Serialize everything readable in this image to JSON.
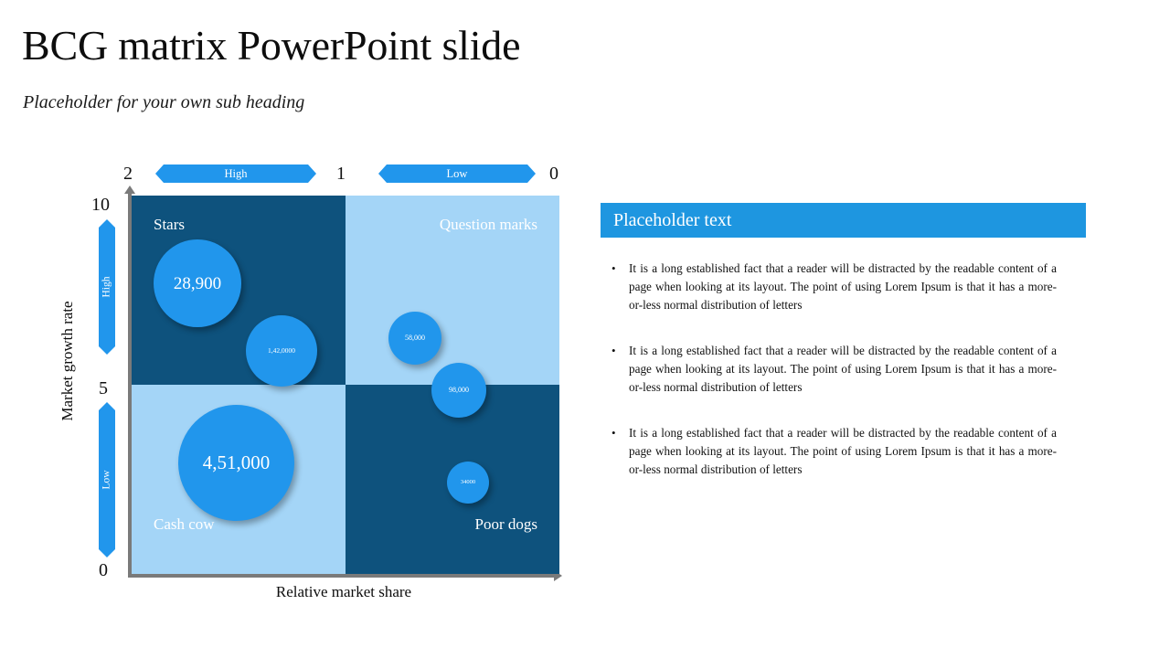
{
  "slide": {
    "title": "BCG matrix PowerPoint slide",
    "subtitle": "Placeholder for your own sub heading"
  },
  "matrix": {
    "x_axis": {
      "title": "Relative market share",
      "ticks": [
        "2",
        "1",
        "0"
      ],
      "bands": [
        {
          "label": "High"
        },
        {
          "label": "Low"
        }
      ]
    },
    "y_axis": {
      "title": "Market growth rate",
      "ticks": [
        "10",
        "5",
        "0"
      ],
      "bands": [
        {
          "label": "High"
        },
        {
          "label": "Low"
        }
      ]
    },
    "quadrants": [
      {
        "key": "stars",
        "label": "Stars",
        "fill": "#0e527d"
      },
      {
        "key": "question_marks",
        "label": "Question marks",
        "fill": "#a4d5f7"
      },
      {
        "key": "cash_cow",
        "label": "Cash cow",
        "fill": "#a4d5f7"
      },
      {
        "key": "poor_dogs",
        "label": "Poor dogs",
        "fill": "#0e527d"
      }
    ]
  },
  "chart_data": {
    "type": "scatter",
    "title": "BCG matrix PowerPoint slide",
    "xlabel": "Relative market share",
    "ylabel": "Market growth rate",
    "xlim": [
      2,
      0
    ],
    "ylim": [
      0,
      10
    ],
    "xticks": [
      "2",
      "1",
      "0"
    ],
    "yticks": [
      "10",
      "5",
      "0"
    ],
    "grid": false,
    "legend": "none",
    "bubble_color": "#2196ec",
    "quadrants": [
      "Stars",
      "Question marks",
      "Cash cow",
      "Poor dogs"
    ],
    "points": [
      {
        "quadrant": "Stars",
        "label": "28,900",
        "value": 28900,
        "size": 96
      },
      {
        "quadrant": "Stars",
        "label": "1,42,0000",
        "value": 1420000,
        "size": 78
      },
      {
        "quadrant": "Question marks",
        "label": "58,000",
        "value": 58000,
        "size": 58
      },
      {
        "quadrant": "Question marks",
        "label": "98,000",
        "value": 98000,
        "size": 60
      },
      {
        "quadrant": "Cash cow",
        "label": "4,51,000",
        "value": 451000,
        "size": 127
      },
      {
        "quadrant": "Poor dogs",
        "label": "34000",
        "value": 34000,
        "size": 46
      }
    ]
  },
  "panel": {
    "header": "Placeholder text",
    "bullet_marker": "•",
    "bullets": [
      "It is a long established fact that a reader will be distracted by the readable content of a page when looking at its layout. The point of using Lorem Ipsum is that it has a more-or-less normal distribution of letters",
      "It is a long established fact that a reader will be distracted by the readable content of a page when looking at its layout. The point of using Lorem Ipsum is that it has a more-or-less normal distribution of letters",
      "It is a long established fact that a reader will be distracted by the readable content of a page when looking at its layout. The point of using Lorem Ipsum is that it has a more-or-less normal distribution of letters"
    ]
  }
}
